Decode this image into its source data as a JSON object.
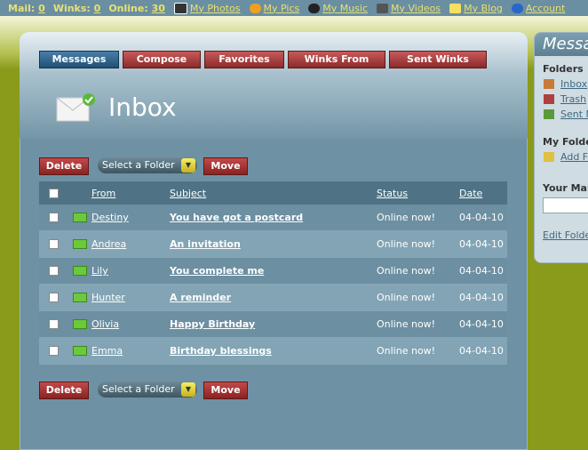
{
  "topbar": {
    "mail_label": "Mail:",
    "mail_count": "0",
    "winks_label": "Winks:",
    "winks_count": "0",
    "online_label": "Online:",
    "online_count": "30",
    "links": [
      "My Photos",
      "My Pics",
      "My Music",
      "My Videos",
      "My Blog",
      "Account"
    ]
  },
  "tabs": [
    "Messages",
    "Compose",
    "Favorites",
    "Winks From",
    "Sent Winks"
  ],
  "page_title": "Inbox",
  "actions": {
    "delete": "Delete",
    "move": "Move",
    "folder_select": "Select a Folder"
  },
  "table": {
    "headers": [
      "From",
      "Subject",
      "Status",
      "Date"
    ],
    "rows": [
      {
        "from": "Destiny",
        "subject": "You have got a postcard",
        "status": "Online now!",
        "date": "04-04-10"
      },
      {
        "from": "Andrea",
        "subject": "An invitation",
        "status": "Online now!",
        "date": "04-04-10"
      },
      {
        "from": "Lily",
        "subject": "You complete me",
        "status": "Online now!",
        "date": "04-04-10"
      },
      {
        "from": "Hunter",
        "subject": "A reminder",
        "status": "Online now!",
        "date": "04-04-10"
      },
      {
        "from": "Olivia",
        "subject": "Happy Birthday",
        "status": "Online now!",
        "date": "04-04-10"
      },
      {
        "from": "Emma",
        "subject": "Birthday blessings",
        "status": "Online now!",
        "date": "04-04-10"
      }
    ]
  },
  "sidebar": {
    "title": "Messag",
    "folders_heading": "Folders",
    "folders": [
      "Inbox",
      "Trash",
      "Sent M"
    ],
    "my_folders_heading": "My Folde",
    "add_folder": "Add Fo",
    "your_mail_heading": "Your Mail",
    "edit_folders": "Edit Folder"
  }
}
